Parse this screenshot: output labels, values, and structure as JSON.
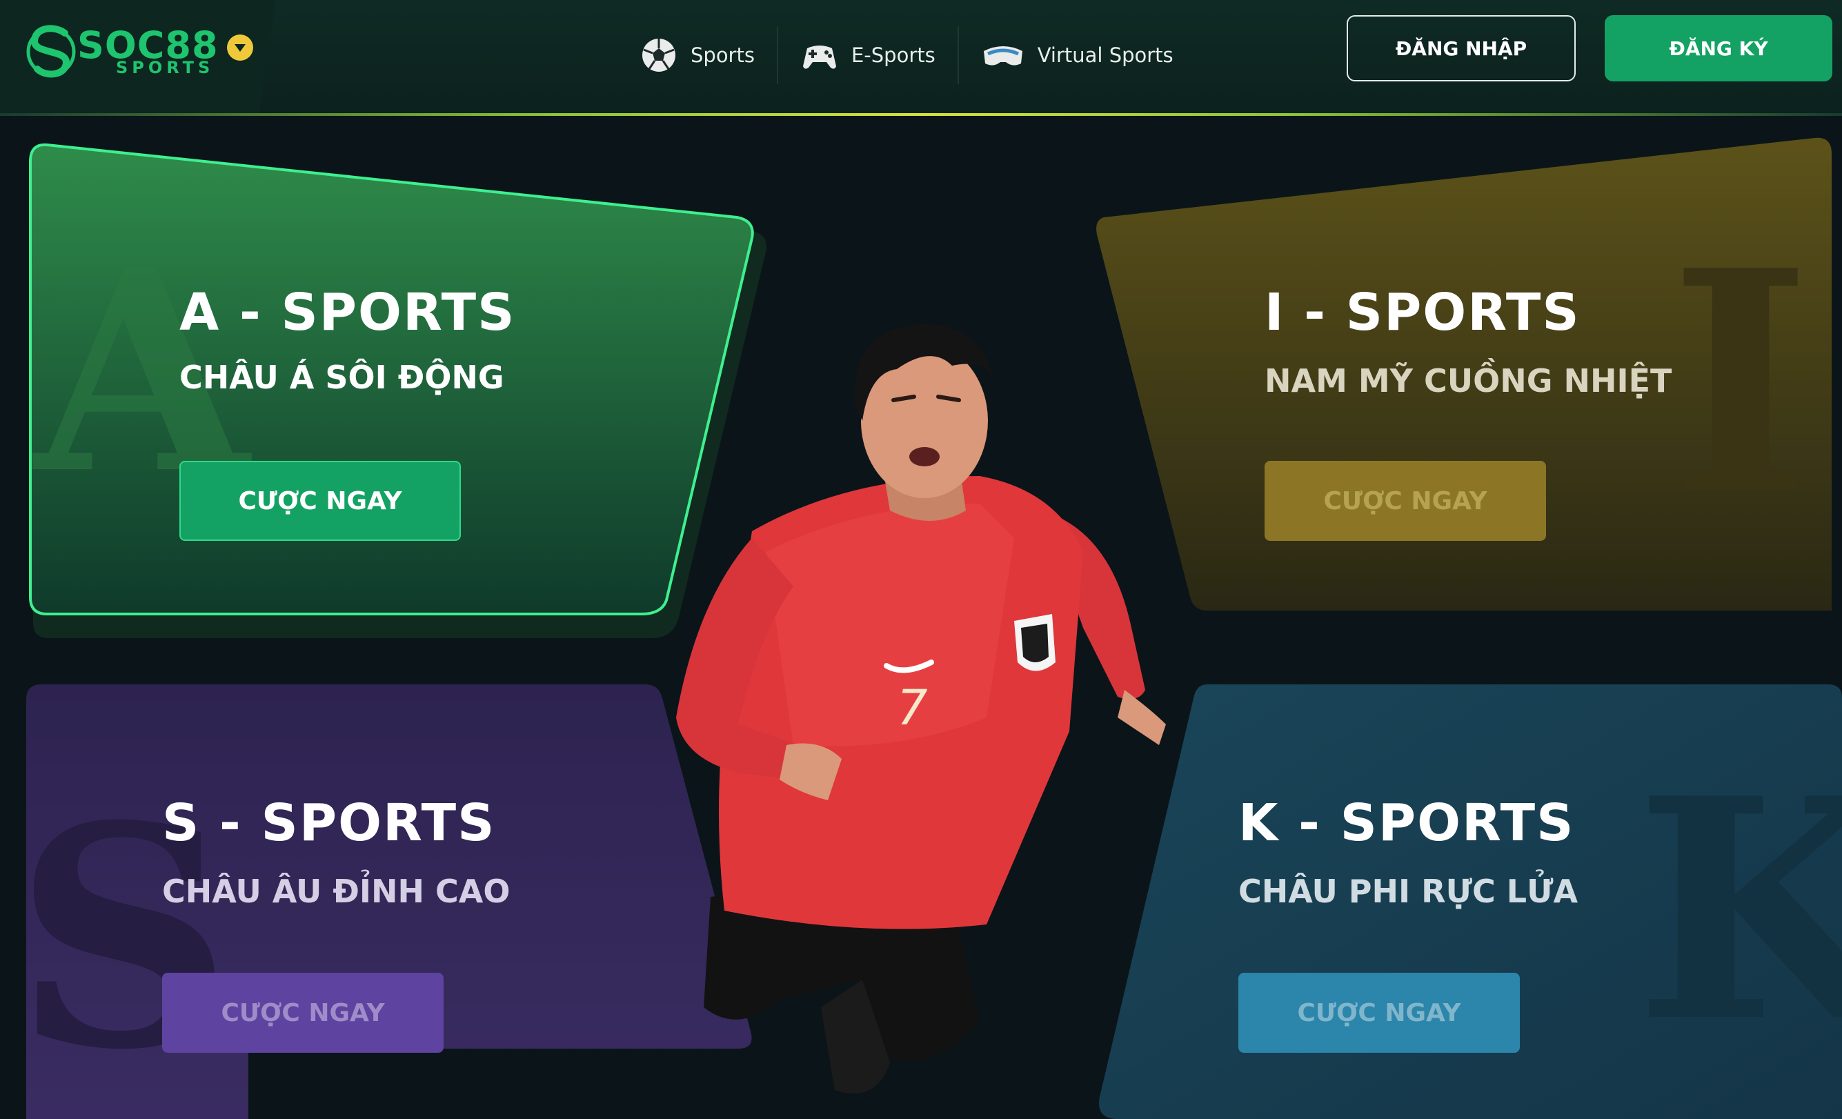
{
  "header": {
    "logo": {
      "text": "SOC88",
      "sub": "SPORTS"
    },
    "nav": [
      {
        "label": "Sports",
        "icon": "soccer-ball-icon"
      },
      {
        "label": "E-Sports",
        "icon": "gamepad-icon"
      },
      {
        "label": "Virtual Sports",
        "icon": "vr-headset-icon"
      }
    ],
    "login_label": "ĐĂNG NHẬP",
    "register_label": "ĐĂNG KÝ"
  },
  "cards": {
    "a": {
      "letter": "A",
      "title": "A - SPORTS",
      "subtitle": "CHÂU Á SÔI ĐỘNG",
      "button": "CƯỢC NGAY",
      "color": "#1f7a45"
    },
    "i": {
      "letter": "I",
      "title": "I - SPORTS",
      "subtitle": "NAM MỸ CUỒNG NHIỆT",
      "button": "CƯỢC NGAY",
      "color": "#5e5218"
    },
    "s": {
      "letter": "S",
      "title": "S - SPORTS",
      "subtitle": "CHÂU ÂU ĐỈNH CAO",
      "button": "CƯỢC NGAY",
      "color": "#2e2452"
    },
    "k": {
      "letter": "K",
      "title": "K - SPORTS",
      "subtitle": "CHÂU PHI RỰC LỬA",
      "button": "CƯỢC NGAY",
      "color": "#173e52"
    }
  },
  "player": {
    "jersey_number": "7"
  },
  "colors": {
    "brand": "#1ec46e",
    "accent": "#13a263",
    "background": "#0b1519"
  }
}
